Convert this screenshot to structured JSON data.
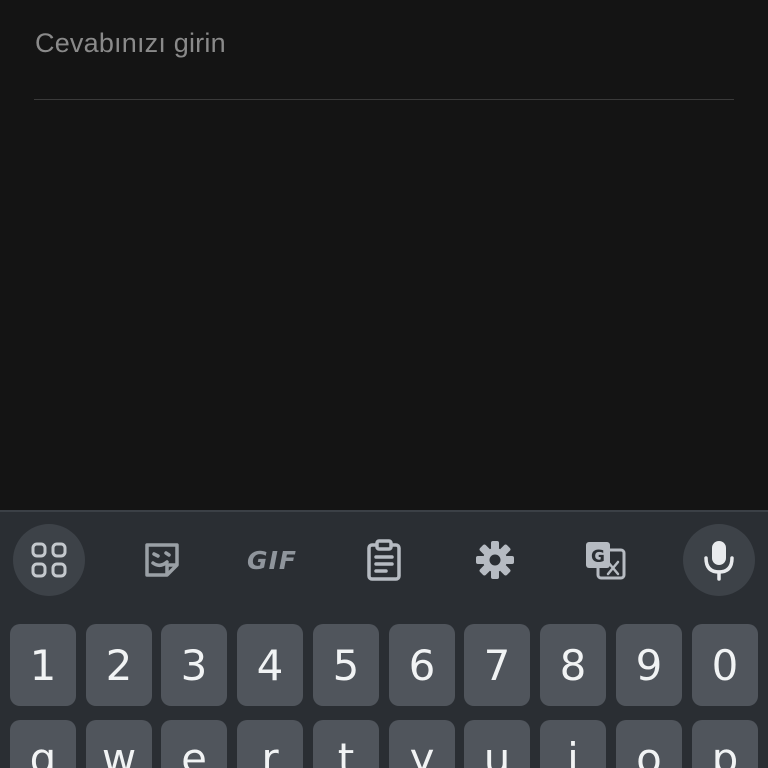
{
  "answer": {
    "placeholder": "Cevabınızı girin"
  },
  "keyboard": {
    "toolbar": {
      "gif_label": "GIF"
    },
    "number_row": [
      "1",
      "2",
      "3",
      "4",
      "5",
      "6",
      "7",
      "8",
      "9",
      "0"
    ],
    "letter_row": [
      "q",
      "w",
      "e",
      "r",
      "t",
      "y",
      "u",
      "i",
      "o",
      "p"
    ]
  },
  "icons": {
    "apps": "apps-grid-icon",
    "sticker": "sticker-icon",
    "gif": "gif-icon",
    "clipboard": "clipboard-icon",
    "settings": "gear-icon",
    "translate": "translate-icon",
    "voice": "microphone-icon"
  },
  "colors": {
    "background": "#141414",
    "keyboard_bg": "#2a2e33",
    "key_bg": "#50555c",
    "placeholder_text": "#8a8a8a",
    "key_text": "#f1f3f4"
  }
}
